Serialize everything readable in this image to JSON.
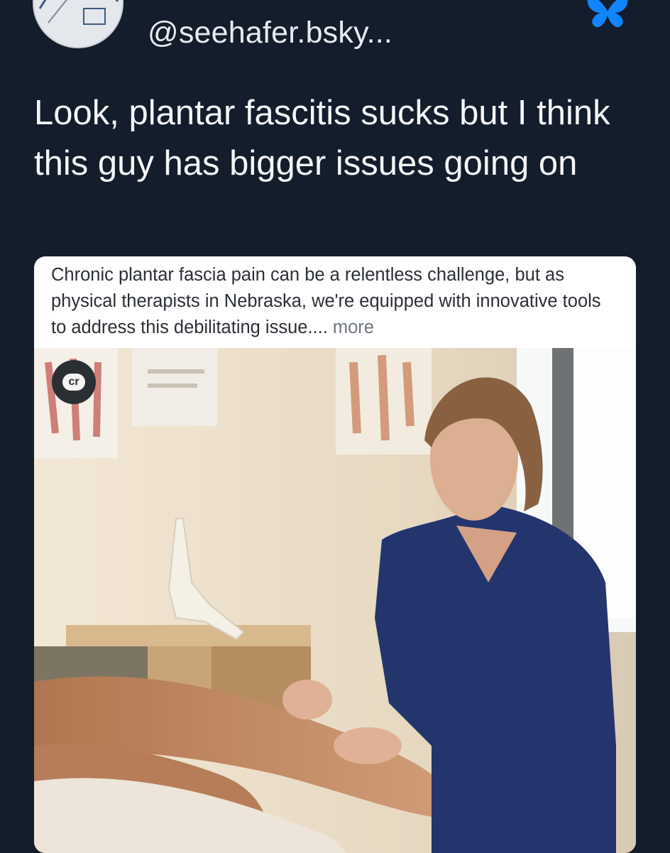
{
  "post": {
    "handle": "@seehafer.bsky...",
    "text": "Look, plantar fascitis sucks but I think this guy has bigger issues going on"
  },
  "card": {
    "caption": "Chronic plantar fascia pain can be a relentless challenge, but as physical therapists in Nebraska, we're equipped with innovative tools to address this debilitating issue....",
    "more_label": " more",
    "badge_label": "cr"
  },
  "icons": {
    "app_logo": "bluesky-butterfly-icon",
    "badge": "content-credentials-icon"
  },
  "colors": {
    "background": "#141d2b",
    "text": "#f4f6f8",
    "brand": "#1185fe"
  }
}
